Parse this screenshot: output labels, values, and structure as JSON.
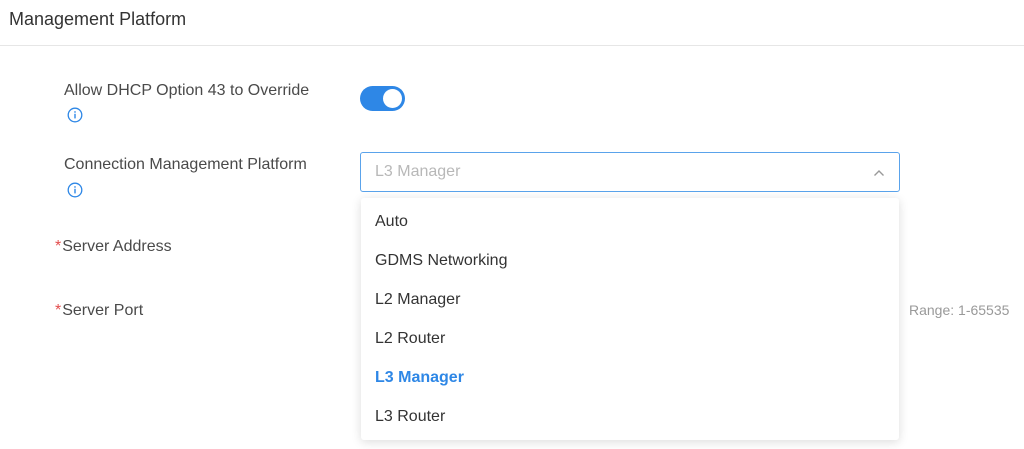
{
  "header": {
    "title": "Management Platform"
  },
  "form": {
    "dhcp_override": {
      "label": "Allow DHCP Option 43 to Override",
      "enabled": true,
      "info_icon": "info-circle-icon"
    },
    "connection_platform": {
      "label": "Connection Management Platform",
      "selected": "L3 Manager",
      "info_icon": "info-circle-icon",
      "expanded": true,
      "options": [
        "Auto",
        "GDMS Networking",
        "L2 Manager",
        "L2 Router",
        "L3 Manager",
        "L3 Router"
      ]
    },
    "server_address": {
      "required_mark": "*",
      "label": "Server Address"
    },
    "server_port": {
      "required_mark": "*",
      "label": "Server Port",
      "hint": "Range: 1-65535"
    }
  },
  "colors": {
    "accent": "#2e87e6",
    "required": "#e34d4d",
    "focus_border": "#5aa3eb"
  }
}
